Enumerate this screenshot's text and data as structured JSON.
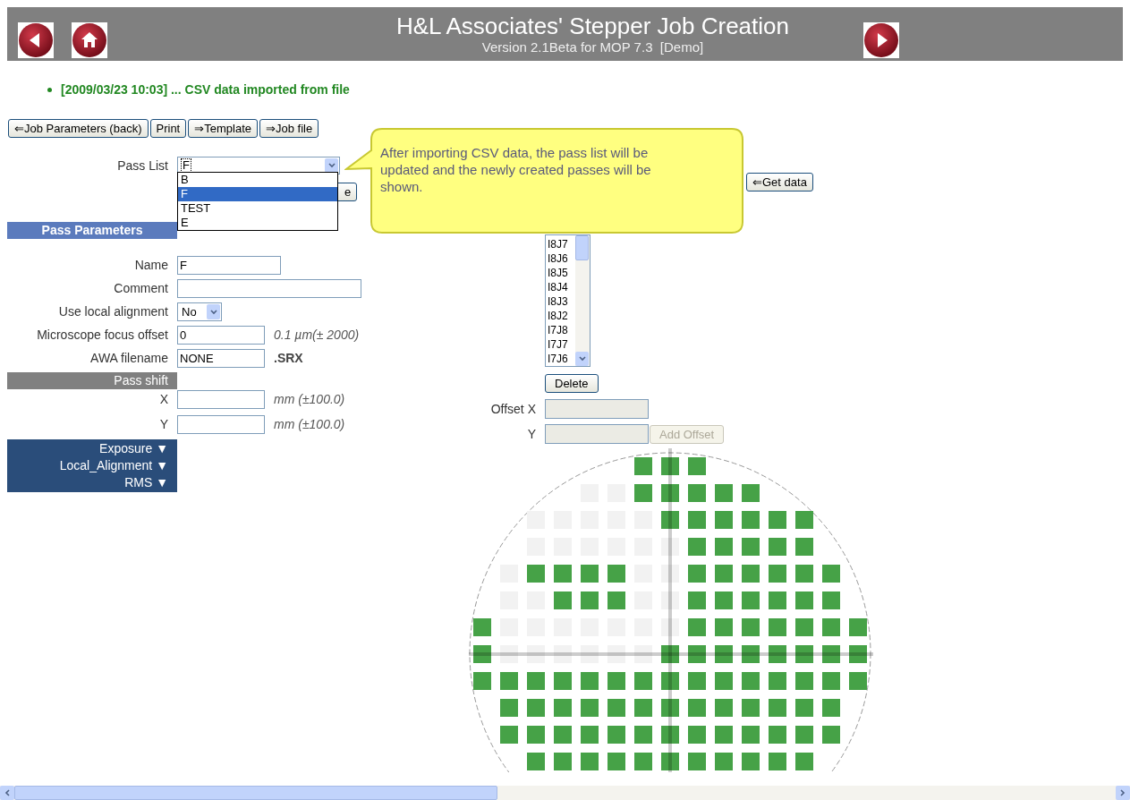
{
  "header": {
    "title": "H&L Associates' Stepper Job Creation",
    "subtitle": "Version 2.1Beta for MOP 7.3  [Demo]"
  },
  "nav": {
    "left": [
      {
        "kind": "back"
      },
      {
        "kind": "home"
      }
    ],
    "right": [
      {
        "kind": "forward"
      }
    ]
  },
  "messages": [
    "[2009/03/23 10:03] ... CSV data imported from file"
  ],
  "toolbar": [
    "⇐Job Parameters (back)",
    "Print",
    "⇒Template",
    "⇒Job file"
  ],
  "pass_list": {
    "label": "Pass List",
    "value": "F",
    "expanded": true,
    "options": [
      {
        "label": "B",
        "selected": false
      },
      {
        "label": "F",
        "selected": true
      },
      {
        "label": "TEST",
        "selected": false
      },
      {
        "label": "E",
        "selected": false
      }
    ]
  },
  "covered_button": {
    "label": "e"
  },
  "pass_parameters": {
    "title": "Pass Parameters",
    "fields": [
      {
        "label": "Name",
        "kind": "short",
        "value": "F"
      },
      {
        "label": "Comment",
        "kind": "long"
      },
      {
        "label": "Use local alignment",
        "kind": "select",
        "value": "No"
      },
      {
        "label": "Microscope focus offset",
        "kind": "number",
        "value": "0",
        "hint": "0.1 µm(± 2000)"
      },
      {
        "label": "AWA filename",
        "kind": "number",
        "value": "NONE",
        "suffix": ".SRX"
      }
    ]
  },
  "pass_shift": {
    "title": "Pass shift",
    "fields": [
      {
        "label": "X",
        "hint": "mm (±100.0)"
      },
      {
        "label": "Y",
        "hint": "mm (±100.0)"
      }
    ]
  },
  "sections": [
    {
      "label": "Exposure",
      "toggle": "▼"
    },
    {
      "label": "Local_Alignment",
      "toggle": "▼"
    },
    {
      "label": "RMS",
      "toggle": "▼"
    }
  ],
  "tooltip": {
    "text": "After importing CSV data, the pass list will be updated and the newly created passes will be shown."
  },
  "get_data_button": "⇐Get data",
  "die_list": {
    "items": [
      "I8J7",
      "I8J6",
      "I8J5",
      "I8J4",
      "I8J3",
      "I8J2",
      "I7J8",
      "I7J7",
      "I7J6"
    ]
  },
  "delete_button": "Delete",
  "offset": {
    "fields": [
      {
        "label": "Offset X",
        "disabled": true
      },
      {
        "label": "Y",
        "disabled": true
      }
    ],
    "add_button": {
      "label": "Add Offset",
      "disabled": true
    }
  },
  "wafer_map": {
    "rows": [
      {
        "cells": [
          {
            "kind": "off"
          },
          {
            "kind": "off"
          },
          {
            "kind": "off"
          },
          {
            "kind": "off"
          },
          {
            "kind": "off"
          },
          {
            "kind": "off"
          },
          {
            "kind": "die"
          },
          {
            "kind": "die"
          },
          {
            "kind": "die"
          },
          {
            "kind": "off"
          },
          {
            "kind": "off"
          },
          {
            "kind": "off"
          },
          {
            "kind": "off"
          },
          {
            "kind": "off"
          },
          {
            "kind": "off"
          }
        ]
      },
      {
        "cells": [
          {
            "kind": "off"
          },
          {
            "kind": "off"
          },
          {
            "kind": "off"
          },
          {
            "kind": "off"
          },
          {
            "kind": "blank"
          },
          {
            "kind": "blank"
          },
          {
            "kind": "die"
          },
          {
            "kind": "die"
          },
          {
            "kind": "die"
          },
          {
            "kind": "die"
          },
          {
            "kind": "die"
          },
          {
            "kind": "off"
          },
          {
            "kind": "off"
          },
          {
            "kind": "off"
          },
          {
            "kind": "off"
          }
        ]
      },
      {
        "cells": [
          {
            "kind": "off"
          },
          {
            "kind": "off"
          },
          {
            "kind": "blank"
          },
          {
            "kind": "blank"
          },
          {
            "kind": "blank"
          },
          {
            "kind": "blank"
          },
          {
            "kind": "blank"
          },
          {
            "kind": "die"
          },
          {
            "kind": "die"
          },
          {
            "kind": "die"
          },
          {
            "kind": "die"
          },
          {
            "kind": "die"
          },
          {
            "kind": "die"
          },
          {
            "kind": "off"
          },
          {
            "kind": "off"
          }
        ]
      },
      {
        "cells": [
          {
            "kind": "off"
          },
          {
            "kind": "off"
          },
          {
            "kind": "blank"
          },
          {
            "kind": "blank"
          },
          {
            "kind": "blank"
          },
          {
            "kind": "blank"
          },
          {
            "kind": "blank"
          },
          {
            "kind": "blank"
          },
          {
            "kind": "die"
          },
          {
            "kind": "die"
          },
          {
            "kind": "die"
          },
          {
            "kind": "die"
          },
          {
            "kind": "die"
          },
          {
            "kind": "off"
          },
          {
            "kind": "off"
          }
        ]
      },
      {
        "cells": [
          {
            "kind": "off"
          },
          {
            "kind": "blank"
          },
          {
            "kind": "die"
          },
          {
            "kind": "die"
          },
          {
            "kind": "die"
          },
          {
            "kind": "die"
          },
          {
            "kind": "blank"
          },
          {
            "kind": "blank"
          },
          {
            "kind": "die"
          },
          {
            "kind": "die"
          },
          {
            "kind": "die"
          },
          {
            "kind": "die"
          },
          {
            "kind": "die"
          },
          {
            "kind": "die"
          },
          {
            "kind": "off"
          }
        ]
      },
      {
        "cells": [
          {
            "kind": "off"
          },
          {
            "kind": "blank"
          },
          {
            "kind": "blank"
          },
          {
            "kind": "die"
          },
          {
            "kind": "die"
          },
          {
            "kind": "die"
          },
          {
            "kind": "blank"
          },
          {
            "kind": "blank"
          },
          {
            "kind": "die"
          },
          {
            "kind": "die"
          },
          {
            "kind": "die"
          },
          {
            "kind": "die"
          },
          {
            "kind": "die"
          },
          {
            "kind": "die"
          },
          {
            "kind": "off"
          }
        ]
      },
      {
        "cells": [
          {
            "kind": "die"
          },
          {
            "kind": "blank"
          },
          {
            "kind": "blank"
          },
          {
            "kind": "blank"
          },
          {
            "kind": "blank"
          },
          {
            "kind": "blank"
          },
          {
            "kind": "blank"
          },
          {
            "kind": "blank"
          },
          {
            "kind": "die"
          },
          {
            "kind": "die"
          },
          {
            "kind": "die"
          },
          {
            "kind": "die"
          },
          {
            "kind": "die"
          },
          {
            "kind": "die"
          },
          {
            "kind": "die"
          }
        ]
      },
      {
        "cells": [
          {
            "kind": "die"
          },
          {
            "kind": "blank"
          },
          {
            "kind": "blank"
          },
          {
            "kind": "blank"
          },
          {
            "kind": "blank"
          },
          {
            "kind": "blank"
          },
          {
            "kind": "blank"
          },
          {
            "kind": "die"
          },
          {
            "kind": "die"
          },
          {
            "kind": "die"
          },
          {
            "kind": "die"
          },
          {
            "kind": "die"
          },
          {
            "kind": "die"
          },
          {
            "kind": "die"
          },
          {
            "kind": "die"
          }
        ]
      },
      {
        "cells": [
          {
            "kind": "die"
          },
          {
            "kind": "die"
          },
          {
            "kind": "die"
          },
          {
            "kind": "die"
          },
          {
            "kind": "die"
          },
          {
            "kind": "die"
          },
          {
            "kind": "die"
          },
          {
            "kind": "die"
          },
          {
            "kind": "die"
          },
          {
            "kind": "die"
          },
          {
            "kind": "die"
          },
          {
            "kind": "die"
          },
          {
            "kind": "die"
          },
          {
            "kind": "die"
          },
          {
            "kind": "die"
          }
        ]
      },
      {
        "cells": [
          {
            "kind": "off"
          },
          {
            "kind": "die"
          },
          {
            "kind": "die"
          },
          {
            "kind": "die"
          },
          {
            "kind": "die"
          },
          {
            "kind": "die"
          },
          {
            "kind": "die"
          },
          {
            "kind": "die"
          },
          {
            "kind": "die"
          },
          {
            "kind": "die"
          },
          {
            "kind": "die"
          },
          {
            "kind": "die"
          },
          {
            "kind": "die"
          },
          {
            "kind": "die"
          },
          {
            "kind": "off"
          }
        ]
      },
      {
        "cells": [
          {
            "kind": "off"
          },
          {
            "kind": "die"
          },
          {
            "kind": "die"
          },
          {
            "kind": "die"
          },
          {
            "kind": "die"
          },
          {
            "kind": "die"
          },
          {
            "kind": "die"
          },
          {
            "kind": "die"
          },
          {
            "kind": "die"
          },
          {
            "kind": "die"
          },
          {
            "kind": "die"
          },
          {
            "kind": "die"
          },
          {
            "kind": "die"
          },
          {
            "kind": "die"
          },
          {
            "kind": "off"
          }
        ]
      },
      {
        "cells": [
          {
            "kind": "off"
          },
          {
            "kind": "off"
          },
          {
            "kind": "die"
          },
          {
            "kind": "die"
          },
          {
            "kind": "die"
          },
          {
            "kind": "die"
          },
          {
            "kind": "die"
          },
          {
            "kind": "die"
          },
          {
            "kind": "die"
          },
          {
            "kind": "die"
          },
          {
            "kind": "die"
          },
          {
            "kind": "die"
          },
          {
            "kind": "die"
          },
          {
            "kind": "off"
          },
          {
            "kind": "off"
          }
        ]
      }
    ]
  }
}
